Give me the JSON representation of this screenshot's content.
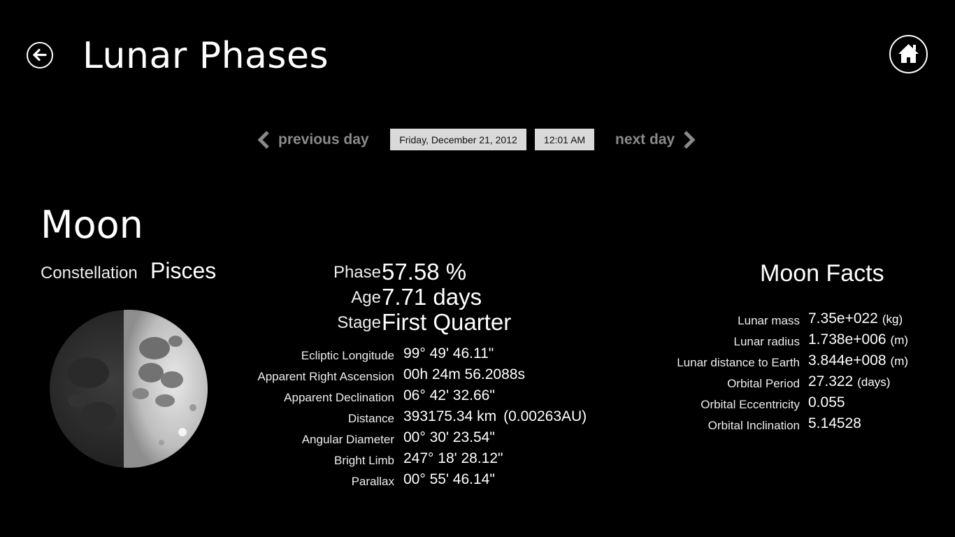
{
  "header": {
    "title": "Lunar Phases",
    "back_icon": "back-arrow-icon",
    "home_icon": "home-icon"
  },
  "date_nav": {
    "previous_label": "previous day",
    "next_label": "next day",
    "date": "Friday, December 21, 2012",
    "time": "12:01 AM"
  },
  "moon": {
    "heading": "Moon",
    "constellation_label": "Constellation",
    "constellation_value": "Pisces",
    "phase_fraction_illuminated": 0.5758
  },
  "phase": {
    "rows": [
      {
        "label": "Phase",
        "value": "57.58 %"
      },
      {
        "label": "Age",
        "value": "7.71 days"
      },
      {
        "label": "Stage",
        "value": "First Quarter"
      }
    ]
  },
  "details": {
    "rows": [
      {
        "label": "Ecliptic Longitude",
        "value": "99° 49' 46.11\""
      },
      {
        "label": "Apparent Right Ascension",
        "value": "00h 24m 56.2088s"
      },
      {
        "label": "Apparent Declination",
        "value": "06° 42' 32.66\""
      },
      {
        "label": "Distance",
        "value": "393175.34 km",
        "extra": "(0.00263AU)"
      },
      {
        "label": "Angular Diameter",
        "value": "00° 30' 23.54\""
      },
      {
        "label": "Bright Limb",
        "value": "247° 18' 28.12\""
      },
      {
        "label": "Parallax",
        "value": "00° 55' 46.14\""
      }
    ]
  },
  "facts": {
    "heading": "Moon Facts",
    "rows": [
      {
        "label": "Lunar mass",
        "value": "7.35e+022",
        "unit": "(kg)"
      },
      {
        "label": "Lunar radius",
        "value": "1.738e+006",
        "unit": "(m)"
      },
      {
        "label": "Lunar distance to Earth",
        "value": "3.844e+008",
        "unit": "(m)"
      },
      {
        "label": "Orbital Period",
        "value": "27.322",
        "unit": "(days)"
      },
      {
        "label": "Orbital Eccentricity",
        "value": "0.055",
        "unit": ""
      },
      {
        "label": "Orbital Inclination",
        "value": "5.14528",
        "unit": ""
      }
    ]
  }
}
